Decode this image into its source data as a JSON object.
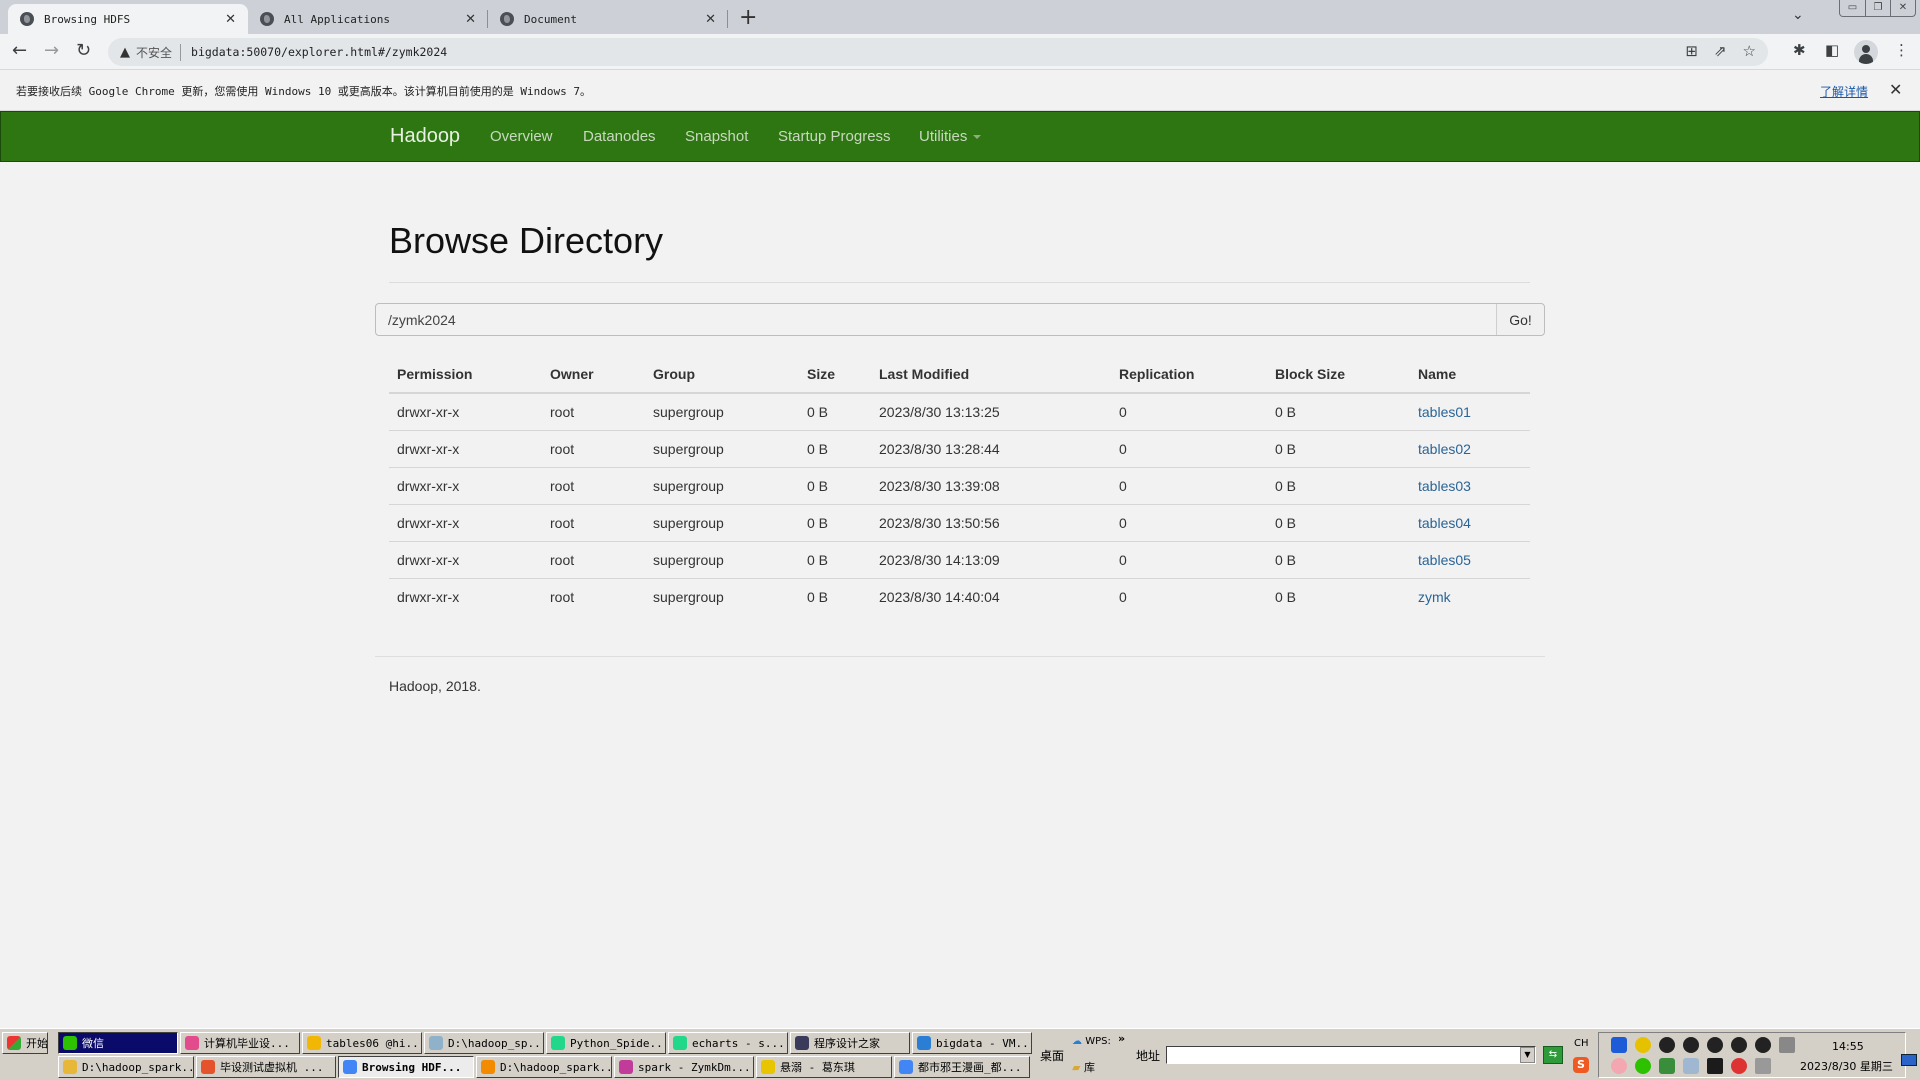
{
  "browser": {
    "tabs": [
      {
        "title": "Browsing HDFS",
        "active": true
      },
      {
        "title": "All Applications",
        "active": false
      },
      {
        "title": "Document",
        "active": false
      }
    ],
    "security_label": "不安全",
    "url": "bigdata:50070/explorer.html#/zymk2024",
    "infobar": {
      "message": "若要接收后续 Google Chrome 更新，您需使用 Windows 10 或更高版本。该计算机目前使用的是 Windows 7。",
      "link": "了解详情"
    }
  },
  "navbar": {
    "brand": "Hadoop",
    "items": [
      "Overview",
      "Datanodes",
      "Snapshot",
      "Startup Progress",
      "Utilities"
    ]
  },
  "main": {
    "title": "Browse Directory",
    "path_value": "/zymk2024",
    "go_label": "Go!",
    "columns": [
      "Permission",
      "Owner",
      "Group",
      "Size",
      "Last Modified",
      "Replication",
      "Block Size",
      "Name"
    ],
    "rows": [
      {
        "permission": "drwxr-xr-x",
        "owner": "root",
        "group": "supergroup",
        "size": "0 B",
        "modified": "2023/8/30 13:13:25",
        "replication": "0",
        "block_size": "0 B",
        "name": "tables01"
      },
      {
        "permission": "drwxr-xr-x",
        "owner": "root",
        "group": "supergroup",
        "size": "0 B",
        "modified": "2023/8/30 13:28:44",
        "replication": "0",
        "block_size": "0 B",
        "name": "tables02"
      },
      {
        "permission": "drwxr-xr-x",
        "owner": "root",
        "group": "supergroup",
        "size": "0 B",
        "modified": "2023/8/30 13:39:08",
        "replication": "0",
        "block_size": "0 B",
        "name": "tables03"
      },
      {
        "permission": "drwxr-xr-x",
        "owner": "root",
        "group": "supergroup",
        "size": "0 B",
        "modified": "2023/8/30 13:50:56",
        "replication": "0",
        "block_size": "0 B",
        "name": "tables04"
      },
      {
        "permission": "drwxr-xr-x",
        "owner": "root",
        "group": "supergroup",
        "size": "0 B",
        "modified": "2023/8/30 14:13:09",
        "replication": "0",
        "block_size": "0 B",
        "name": "tables05"
      },
      {
        "permission": "drwxr-xr-x",
        "owner": "root",
        "group": "supergroup",
        "size": "0 B",
        "modified": "2023/8/30 14:40:04",
        "replication": "0",
        "block_size": "0 B",
        "name": "zymk"
      }
    ],
    "footer": "Hadoop, 2018."
  },
  "taskbar": {
    "start_label": "开始",
    "row1": [
      {
        "label": "微信",
        "icon_color": "#2dc100",
        "state": "pressed"
      },
      {
        "label": "计算机毕业设...",
        "icon_color": "#e34c8c",
        "state": "normal"
      },
      {
        "label": "tables06 @hi...",
        "icon_color": "#f2b705",
        "state": "normal"
      },
      {
        "label": "D:\\hadoop_sp...",
        "icon_color": "#8fb1c9",
        "state": "normal"
      },
      {
        "label": "Python_Spide...",
        "icon_color": "#21d789",
        "state": "normal"
      },
      {
        "label": "echarts - s...",
        "icon_color": "#21d789",
        "state": "normal"
      },
      {
        "label": "程序设计之家",
        "icon_color": "#3a3a5a",
        "state": "normal"
      },
      {
        "label": "bigdata - VM...",
        "icon_color": "#2a7fd4",
        "state": "normal"
      }
    ],
    "row2": [
      {
        "label": "D:\\hadoop_spark...",
        "icon_color": "#e7b73a",
        "state": "normal"
      },
      {
        "label": "毕设测试虚拟机 ...",
        "icon_color": "#e5532d",
        "state": "normal"
      },
      {
        "label": "Browsing HDF...",
        "icon_color": "#4285f4",
        "state": "active"
      },
      {
        "label": "D:\\hadoop_spark...",
        "icon_color": "#f28b00",
        "state": "normal"
      },
      {
        "label": "spark - ZymkDm...",
        "icon_color": "#c13c9a",
        "state": "normal"
      },
      {
        "label": "悬溺 - 葛东琪",
        "icon_color": "#e8c500",
        "state": "normal"
      },
      {
        "label": "都市邪王漫画_都...",
        "icon_color": "#4285f4",
        "state": "normal"
      }
    ],
    "quicklaunch": {
      "desktop": "桌面",
      "wps": "WPS:",
      "library": "库",
      "more": "»"
    },
    "address_label": "地址",
    "address_value": "",
    "ime": "CH",
    "clock_time": "14:55",
    "clock_date": "2023/8/30 星期三"
  }
}
